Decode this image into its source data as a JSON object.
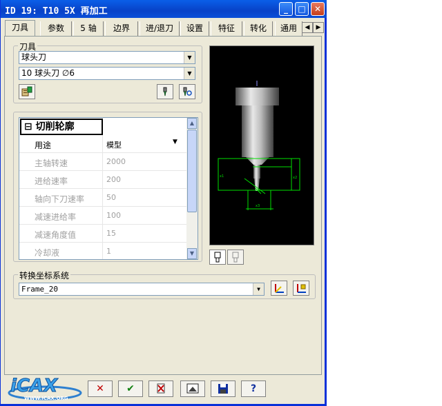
{
  "window": {
    "title": "ID 19: T10 5X 再加工"
  },
  "tabs": [
    {
      "label": "刀具"
    },
    {
      "label": "参数"
    },
    {
      "label": "5 轴"
    },
    {
      "label": "边界"
    },
    {
      "label": "进/退刀"
    },
    {
      "label": "设置"
    },
    {
      "label": "特征"
    },
    {
      "label": "转化"
    },
    {
      "label": "通用"
    }
  ],
  "tool_group": {
    "label": "刀具",
    "tool_type": "球头刀",
    "tool_select": "10  球头刀  ∅6"
  },
  "cut_profile": {
    "header": "切削轮廓",
    "rows": [
      {
        "key": "用途",
        "value": "模型"
      },
      {
        "key": "主轴转速",
        "value": "2000"
      },
      {
        "key": "进给速率",
        "value": "200"
      },
      {
        "key": "轴向下刀速率",
        "value": "50"
      },
      {
        "key": "减速进给率",
        "value": "100"
      },
      {
        "key": "减速角度值",
        "value": "15"
      },
      {
        "key": "冷却液",
        "value": "1"
      }
    ]
  },
  "transform": {
    "label": "转换坐标系统",
    "frame": "Frame_20"
  },
  "watermark": {
    "brand": "iCAX",
    "url": "WWW.ICAX.ORG"
  },
  "colors": {
    "titlebar": "#0842c8",
    "preview_bg": "#000000",
    "wire": "#00e000"
  }
}
